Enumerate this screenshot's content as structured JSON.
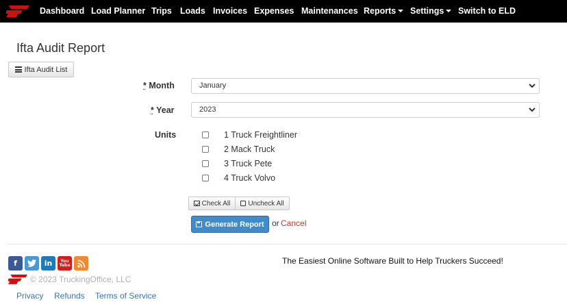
{
  "navbar": {
    "items": [
      {
        "label": "Dashboard",
        "dropdown": false
      },
      {
        "label": "Load Planner",
        "dropdown": false
      },
      {
        "label": "Trips",
        "dropdown": false
      },
      {
        "label": "Loads",
        "dropdown": false
      },
      {
        "label": "Invoices",
        "dropdown": false
      },
      {
        "label": "Expenses",
        "dropdown": false
      },
      {
        "label": "Maintenances",
        "dropdown": false
      },
      {
        "label": "Reports",
        "dropdown": true
      },
      {
        "label": "Settings",
        "dropdown": true
      },
      {
        "label": "Switch to ELD",
        "dropdown": false
      }
    ],
    "brand_color": "#cc1111"
  },
  "page": {
    "title": "Ifta Audit Report",
    "list_button_label": "Ifta Audit List"
  },
  "form": {
    "required_mark": "*",
    "month_label": "Month",
    "month_value": "January",
    "year_label": "Year",
    "year_value": "2023",
    "units_label": "Units",
    "units": [
      {
        "label": "1 Truck Freightliner",
        "checked": false
      },
      {
        "label": "2 Mack Truck",
        "checked": false
      },
      {
        "label": "3 Truck Pete",
        "checked": false
      },
      {
        "label": "4 Truck Volvo",
        "checked": false
      }
    ],
    "check_all_label": "Check All",
    "uncheck_all_label": "Uncheck All",
    "generate_label": "Generate Report",
    "or_text": "or",
    "cancel_label": "Cancel"
  },
  "footer": {
    "social_icons": [
      "facebook-icon",
      "twitter-icon",
      "linkedin-icon",
      "youtube-icon",
      "rss-icon"
    ],
    "youtube_top": "You",
    "youtube_bottom": "Tube",
    "tagline": "The Easiest Online Software Built to Help Truckers Succeed!",
    "copyright": "© 2023 TruckingOffice, LLC",
    "links": [
      "Privacy",
      "Refunds",
      "Terms of Service"
    ]
  }
}
